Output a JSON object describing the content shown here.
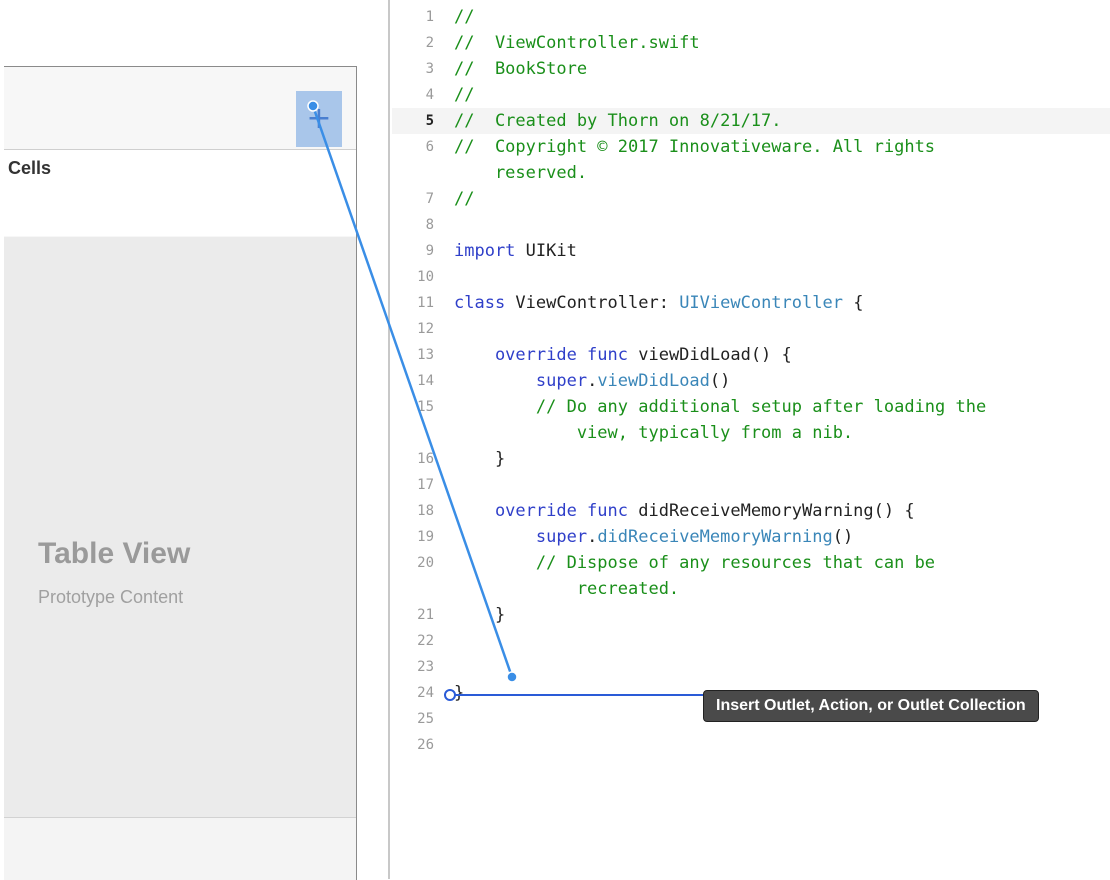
{
  "storyboard": {
    "add_button_icon": "plus-icon",
    "add_button_label": "+",
    "cells_label": "Cells",
    "table_view_title": "Table View",
    "table_view_subtitle": "Prototype Content"
  },
  "editor": {
    "current_line": 5,
    "lines": [
      {
        "n": "1",
        "segments": [
          {
            "t": "//",
            "c": "comment"
          }
        ]
      },
      {
        "n": "2",
        "segments": [
          {
            "t": "//  ViewController.swift",
            "c": "comment"
          }
        ]
      },
      {
        "n": "3",
        "segments": [
          {
            "t": "//  BookStore",
            "c": "comment"
          }
        ]
      },
      {
        "n": "4",
        "segments": [
          {
            "t": "//",
            "c": "comment"
          }
        ]
      },
      {
        "n": "5",
        "segments": [
          {
            "t": "//  Created by Thorn on 8/21/17.",
            "c": "comment"
          }
        ]
      },
      {
        "n": "6",
        "segments": [
          {
            "t": "//  Copyright © 2017 Innovativeware. All rights",
            "c": "comment"
          }
        ]
      },
      {
        "n": "",
        "segments": [
          {
            "t": "    reserved.",
            "c": "comment"
          }
        ]
      },
      {
        "n": "7",
        "segments": [
          {
            "t": "//",
            "c": "comment"
          }
        ]
      },
      {
        "n": "8",
        "segments": []
      },
      {
        "n": "9",
        "segments": [
          {
            "t": "import",
            "c": "kw"
          },
          {
            "t": " UIKit",
            "c": "plain"
          }
        ]
      },
      {
        "n": "10",
        "segments": []
      },
      {
        "n": "11",
        "segments": [
          {
            "t": "class",
            "c": "kw"
          },
          {
            "t": " ViewController: ",
            "c": "plain"
          },
          {
            "t": "UIViewController",
            "c": "type"
          },
          {
            "t": " {",
            "c": "plain"
          }
        ]
      },
      {
        "n": "12",
        "segments": []
      },
      {
        "n": "13",
        "segments": [
          {
            "t": "    override func",
            "c": "kw"
          },
          {
            "t": " viewDidLoad() {",
            "c": "plain"
          }
        ]
      },
      {
        "n": "14",
        "segments": [
          {
            "t": "        super",
            "c": "kw"
          },
          {
            "t": ".",
            "c": "plain"
          },
          {
            "t": "viewDidLoad",
            "c": "fn"
          },
          {
            "t": "()",
            "c": "plain"
          }
        ]
      },
      {
        "n": "15",
        "segments": [
          {
            "t": "        // Do any additional setup after loading the",
            "c": "comment"
          }
        ]
      },
      {
        "n": "",
        "segments": [
          {
            "t": "            view, typically from a nib.",
            "c": "comment"
          }
        ]
      },
      {
        "n": "16",
        "segments": [
          {
            "t": "    }",
            "c": "plain"
          }
        ]
      },
      {
        "n": "17",
        "segments": []
      },
      {
        "n": "18",
        "segments": [
          {
            "t": "    override func",
            "c": "kw"
          },
          {
            "t": " didReceiveMemoryWarning() {",
            "c": "plain"
          }
        ]
      },
      {
        "n": "19",
        "segments": [
          {
            "t": "        super",
            "c": "kw"
          },
          {
            "t": ".",
            "c": "plain"
          },
          {
            "t": "didReceiveMemoryWarning",
            "c": "fn"
          },
          {
            "t": "()",
            "c": "plain"
          }
        ]
      },
      {
        "n": "20",
        "segments": [
          {
            "t": "        // Dispose of any resources that can be",
            "c": "comment"
          }
        ]
      },
      {
        "n": "",
        "segments": [
          {
            "t": "            recreated.",
            "c": "comment"
          }
        ]
      },
      {
        "n": "21",
        "segments": [
          {
            "t": "    }",
            "c": "plain"
          }
        ]
      },
      {
        "n": "22",
        "segments": []
      },
      {
        "n": "23",
        "segments": []
      },
      {
        "n": "24",
        "segments": [
          {
            "t": "}",
            "c": "plain"
          }
        ]
      },
      {
        "n": "25",
        "segments": []
      },
      {
        "n": "26",
        "segments": []
      }
    ]
  },
  "connection": {
    "tooltip": "Insert Outlet, Action, or Outlet Collection",
    "line_color": "#3a8ee6",
    "insert_line_color": "#2a5bd7"
  }
}
